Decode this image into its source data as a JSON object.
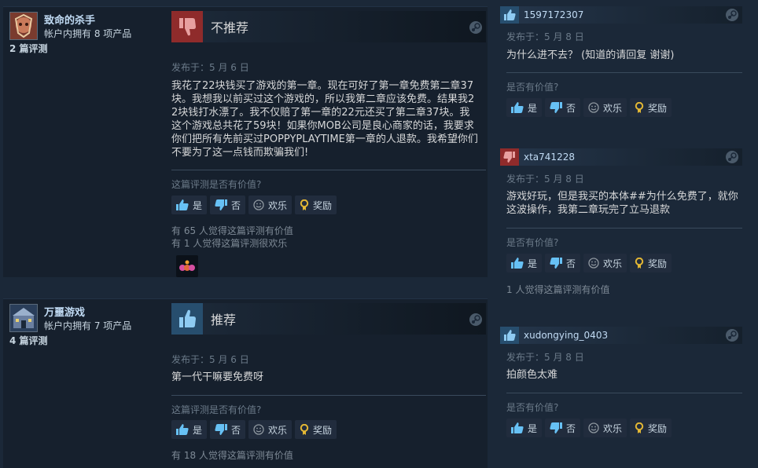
{
  "labels": {
    "helpful_question_review": "这篇评测是否有价值?",
    "helpful_question_comment": "是否有价值?",
    "btn_yes": "是",
    "btn_no": "否",
    "btn_funny": "欢乐",
    "btn_award": "奖励"
  },
  "reviews": [
    {
      "author": "致命的杀手",
      "products": "帐户内拥有 8 项产品",
      "review_count": "2 篇评测",
      "verdict": "不推荐",
      "recommended": false,
      "posted": "发布于：5 月 6 日",
      "text": "我花了22块钱买了游戏的第一章。现在可好了第一章免费第二章37块。我想我以前买过这个游戏的，所以我第二章应该免费。结果我22块钱打水漂了。我不仅赔了第一章的22元还买了第二章37块。我这个游戏总共花了59块！如果你MOB公司是良心商家的话，我要求你们把所有先前买过POPPYPLAYTIME第一章的人退款。我希望你们不要为了这一点钱而欺骗我们!",
      "helpful_stat": "有 65 人觉得这篇评测有价值",
      "funny_stat": "有 1 人觉得这篇评测很欢乐"
    },
    {
      "author": "万噩游戏",
      "products": "帐户内拥有 7 项产品",
      "review_count": "4 篇评测",
      "verdict": "推荐",
      "recommended": true,
      "posted": "发布于：5 月 6 日",
      "text": "第一代干嘛要免费呀",
      "helpful_stat": "有 18 人觉得这篇评测有价值",
      "funny_stat": ""
    }
  ],
  "comments": [
    {
      "user": "1597172307",
      "recommended": true,
      "posted": "发布于：5 月 8 日",
      "text": "为什么进不去？ (知道的请回复 谢谢)",
      "stat": ""
    },
    {
      "user": "xta741228",
      "recommended": false,
      "posted": "发布于：5 月 8 日",
      "text": "游戏好玩，但是我买的本体##为什么免费了，就你这波操作，我第二章玩完了立马退款",
      "stat": "1 人觉得这篇评测有价值"
    },
    {
      "user": "xudongying_0403",
      "recommended": true,
      "posted": "发布于：5 月 8 日",
      "text": "拍颜色太难",
      "stat": ""
    }
  ]
}
